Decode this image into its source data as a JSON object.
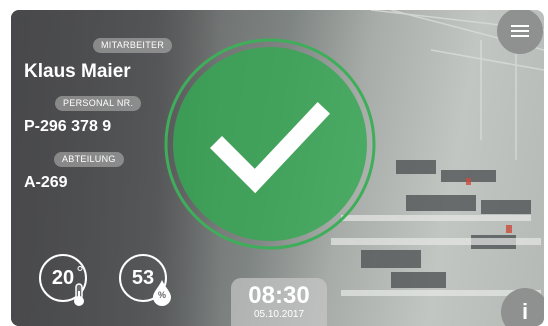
{
  "colors": {
    "accent": "#3fae5a",
    "ring": "#3fae5a"
  },
  "employee": {
    "name_label": "MITARBEITER",
    "name": "Klaus Maier",
    "personnel_label": "PERSONAL NR.",
    "personnel_no": "P-296 378 9",
    "department_label": "ABTEILUNG",
    "department": "A-269"
  },
  "status": {
    "icon": "checkmark-icon"
  },
  "sensors": {
    "temperature": {
      "value": "20",
      "icon": "thermometer-icon"
    },
    "humidity": {
      "value": "53",
      "unit": "%",
      "icon": "droplet-icon"
    }
  },
  "clock": {
    "time": "08:30",
    "date": "05.10.2017"
  },
  "buttons": {
    "menu_icon": "menu-icon",
    "info_label": "i"
  }
}
